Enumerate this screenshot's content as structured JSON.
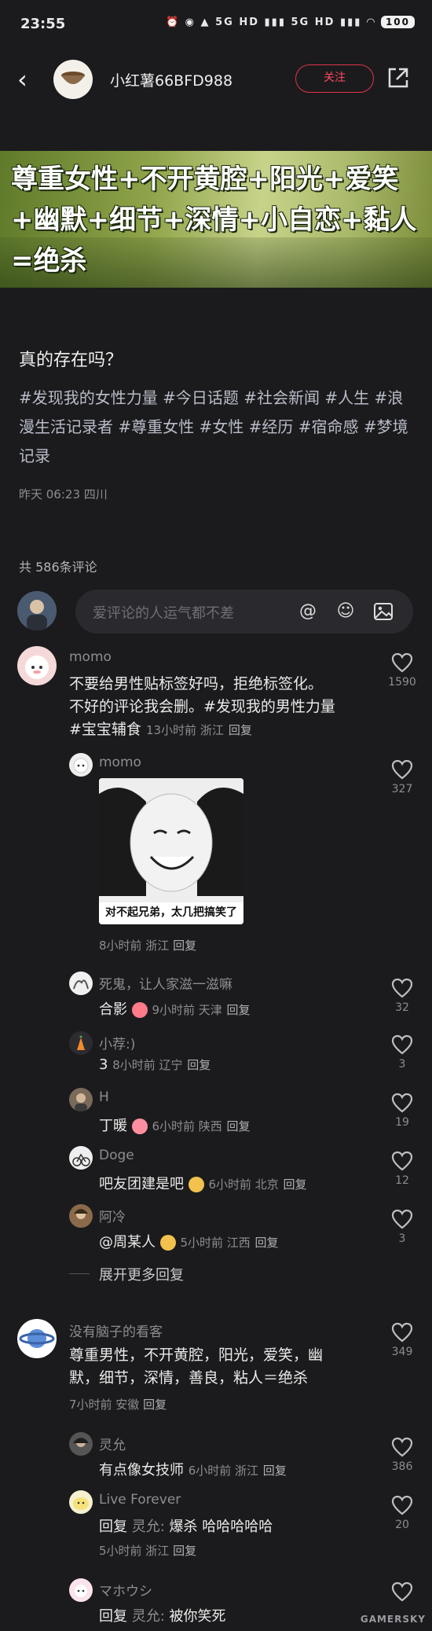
{
  "status_bar": {
    "time": "23:55",
    "icons": "⏰ ◉ ▲ 5G HD ▮▮▮ 5G HD ▮▮▮ ◠",
    "battery": "100"
  },
  "header": {
    "author": "小红薯66BFD988",
    "follow_label": "关注",
    "avatar_icon": "bowl-icon"
  },
  "banner": {
    "text": "尊重女性+不开黄腔+阳光+爱笑+幽默+细节+深情+小自恋+黏人=绝杀"
  },
  "post": {
    "title": "真的存在吗？",
    "hashtags": "#发现我的女性力量 #今日话题 #社会新闻 #人生 #浪漫生活记录者 #尊重女性 #女性 #经历 #宿命感 #梦境记录",
    "meta": "昨天 06:23 四川"
  },
  "comments_header": {
    "count_label": "共 586条评论",
    "input_placeholder": "爱评论的人运气都不差"
  },
  "comments": [
    {
      "name": "momo",
      "text": "不要给男性贴标签好吗，拒绝标签化。不好的评论我会删。#发现我的男性力量 #宝宝辅食",
      "text_l1": "不要给男性贴标签好吗，拒绝标签化。",
      "text_l2": "不好的评论我会删。#发现我的男性力量",
      "text_l3": "#宝宝辅食",
      "meta": "13小时前 浙江",
      "reply": "回复",
      "likes": "1590"
    },
    {
      "name": "没有脑子的看客",
      "text_l1": "尊重男性，不开黄腔，阳光，爱笑，幽",
      "text_l2": "默，细节，深情，善良，粘人＝绝杀",
      "meta": "7小时前 安徽",
      "reply": "回复",
      "likes": "349"
    }
  ],
  "replies_1": [
    {
      "name": "momo",
      "meme_caption": "对不起兄弟，太几把搞笑了",
      "meta": "8小时前 浙江",
      "reply": "回复",
      "likes": "327"
    },
    {
      "name": "死鬼，让人家滋一滋嘛",
      "text": "合影",
      "meta": "9小时前 天津",
      "reply": "回复",
      "likes": "32"
    },
    {
      "name": "小荐:)",
      "text": "3",
      "meta": "8小时前 辽宁",
      "reply": "回复",
      "likes": "3"
    },
    {
      "name": "H",
      "text": "丁暖",
      "meta": "6小时前 陕西",
      "reply": "回复",
      "likes": "19"
    },
    {
      "name": "Doge",
      "text": "吧友团建是吧",
      "meta": "6小时前 北京",
      "reply": "回复",
      "likes": "12"
    },
    {
      "name": "阿冷",
      "text": "@周某人",
      "meta": "5小时前 江西",
      "reply": "回复",
      "likes": "3"
    }
  ],
  "expand_more": "展开更多回复",
  "replies_2": [
    {
      "name": "灵允",
      "text": "有点像女技师",
      "meta": "6小时前 浙江",
      "reply": "回复",
      "likes": "386"
    },
    {
      "name": "Live Forever",
      "prefix": "回复",
      "target": "灵允:",
      "text": "爆杀 哈哈哈哈哈",
      "meta": "5小时前 浙江",
      "reply": "回复",
      "likes": "20"
    },
    {
      "name": "マホウシ",
      "prefix": "回复",
      "target": "灵允:",
      "text": "被你笑死",
      "likes": ""
    }
  ],
  "watermark": "GAMERSKY",
  "colors": {
    "background": "#1b1b1d",
    "accent": "#ff4a60",
    "tag": "#b9bcc8"
  }
}
